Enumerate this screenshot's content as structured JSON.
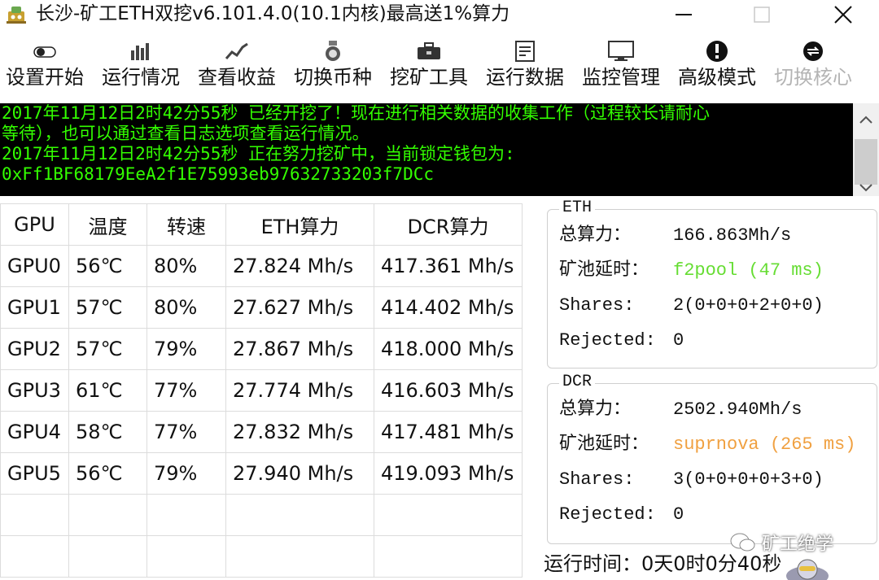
{
  "window": {
    "title": "长沙-矿工ETH双挖v6.101.4.0(10.1内核)最高送1%算力"
  },
  "toolbar": {
    "items": [
      {
        "label": "设置开始",
        "icon": "toggle-icon",
        "disabled": false
      },
      {
        "label": "运行情况",
        "icon": "bar-chart-icon",
        "disabled": false
      },
      {
        "label": "查看收益",
        "icon": "trend-line-icon",
        "disabled": false
      },
      {
        "label": "切换币种",
        "icon": "coin-medal-icon",
        "disabled": false
      },
      {
        "label": "挖矿工具",
        "icon": "toolbox-icon",
        "disabled": false
      },
      {
        "label": "运行数据",
        "icon": "document-icon",
        "disabled": false
      },
      {
        "label": "监控管理",
        "icon": "monitor-icon",
        "disabled": false
      },
      {
        "label": "高级模式",
        "icon": "alert-icon",
        "disabled": false
      },
      {
        "label": "切换核心",
        "icon": "switch-icon",
        "disabled": true
      }
    ]
  },
  "log": {
    "lines": [
      "2017年11月12日2时42分55秒 已经开挖了！现在进行相关数据的收集工作（过程较长请耐心",
      "等待），也可以通过查看日志选项查看运行情况。",
      "2017年11月12日2时42分55秒 正在努力挖矿中，当前锁定钱包为:",
      "0xFf1BF68179EeA2f1E75993eb97632733203f7DCc"
    ]
  },
  "gpu_table": {
    "headers": [
      "GPU",
      "温度",
      "转速",
      "ETH算力",
      "DCR算力"
    ],
    "rows": [
      [
        "GPU0",
        "56℃",
        "80%",
        "27.824 Mh/s",
        "417.361 Mh/s"
      ],
      [
        "GPU1",
        "57℃",
        "80%",
        "27.627 Mh/s",
        "414.402 Mh/s"
      ],
      [
        "GPU2",
        "57℃",
        "79%",
        "27.867 Mh/s",
        "418.000 Mh/s"
      ],
      [
        "GPU3",
        "61℃",
        "77%",
        "27.774 Mh/s",
        "416.603 Mh/s"
      ],
      [
        "GPU4",
        "58℃",
        "77%",
        "27.832 Mh/s",
        "417.481 Mh/s"
      ],
      [
        "GPU5",
        "56℃",
        "79%",
        "27.940 Mh/s",
        "419.093 Mh/s"
      ],
      [
        "",
        "",
        "",
        "",
        ""
      ],
      [
        "",
        "",
        "",
        "",
        ""
      ]
    ]
  },
  "eth": {
    "legend": "ETH",
    "rows": [
      {
        "key": "总算力：",
        "value": "166.863Mh/s"
      },
      {
        "key": "矿池延时：",
        "value": "f2pool (47 ms)"
      },
      {
        "key": "Shares:",
        "value": "2(0+0+0+2+0+0)"
      },
      {
        "key": "Rejected:",
        "value": "0"
      }
    ]
  },
  "dcr": {
    "legend": "DCR",
    "rows": [
      {
        "key": "总算力：",
        "value": "2502.940Mh/s"
      },
      {
        "key": "矿池延时：",
        "value": "suprnova (265 ms)"
      },
      {
        "key": "Shares:",
        "value": "3(0+0+0+0+3+0)"
      },
      {
        "key": "Rejected:",
        "value": "0"
      }
    ]
  },
  "status": {
    "runtime": "运行时间：0天0时0分40秒"
  },
  "watermark": {
    "text": "矿工绝学"
  },
  "colors": {
    "console_bg": "#000000",
    "console_text": "#33ff00",
    "eth_pool": "#66dd33",
    "dcr_pool": "#f0a040",
    "disabled_text": "#b4b4b4"
  }
}
